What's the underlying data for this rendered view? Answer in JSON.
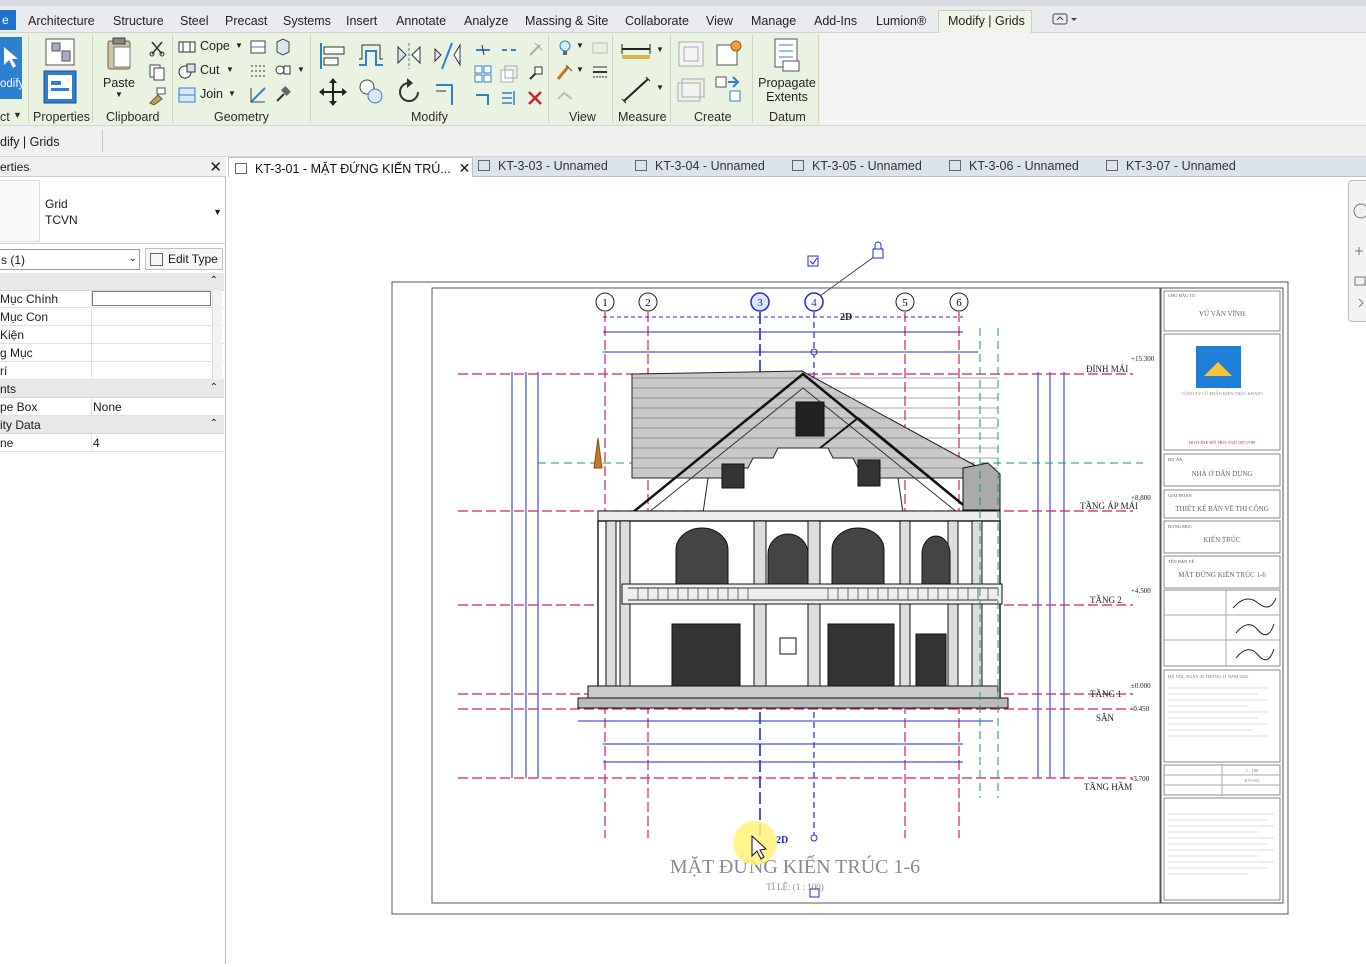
{
  "menu": {
    "file_label": "e",
    "tabs": [
      "Architecture",
      "Structure",
      "Steel",
      "Precast",
      "Systems",
      "Insert",
      "Annotate",
      "Analyze",
      "Massing & Site",
      "Collaborate",
      "View",
      "Manage",
      "Add-Ins",
      "Lumion®",
      "Modify | Grids"
    ],
    "active_tab": "Modify | Grids"
  },
  "ribbon": {
    "modify_label": "odify",
    "select_label": "ct",
    "properties_label": "Properties",
    "paste_label": "Paste",
    "clipboard_label": "Clipboard",
    "cope_label": "Cope",
    "cut_label": "Cut",
    "join_label": "Join",
    "geometry_label": "Geometry",
    "modify_panel_label": "Modify",
    "view_label": "View",
    "measure_label": "Measure",
    "create_label": "Create",
    "propagate_line1": "Propagate",
    "propagate_line2": "Extents",
    "datum_label": "Datum"
  },
  "options_bar": {
    "context_label": "dify | Grids"
  },
  "properties": {
    "title": "erties",
    "type_line1": "Grid",
    "type_line2": "TCVN",
    "filter_value": "s (1)",
    "edit_type_label": "Edit Type",
    "rows": [
      {
        "key": " Mục Chính",
        "value": ""
      },
      {
        "key": " Mục Con",
        "value": ""
      },
      {
        "key": " Kiện",
        "value": ""
      },
      {
        "key": "g Mục",
        "value": ""
      },
      {
        "key": "rí",
        "value": ""
      }
    ],
    "group_extents": "nts",
    "scope_box_key": "pe Box",
    "scope_box_value": "None",
    "group_identity": "ity Data",
    "name_key": "ne",
    "name_value": "4"
  },
  "doc_tabs": [
    {
      "label": "KT-3-01 - MẶT ĐỨNG KIẾN TRÚ...",
      "active": true
    },
    {
      "label": "KT-3-03 - Unnamed",
      "active": false
    },
    {
      "label": "KT-3-04 - Unnamed",
      "active": false
    },
    {
      "label": "KT-3-05 - Unnamed",
      "active": false
    },
    {
      "label": "KT-3-06 - Unnamed",
      "active": false
    },
    {
      "label": "KT-3-07 - Unnamed",
      "active": false
    }
  ],
  "drawing": {
    "grid_labels": [
      "1",
      "2",
      "3",
      "4",
      "5",
      "6"
    ],
    "tag_2d": "2D",
    "level_labels": [
      "ĐỈNH MÁI",
      "TẦNG ÁP MÁI",
      "TẦNG 2",
      "TẦNG 1",
      "SÂN",
      "TẦNG HẦM"
    ],
    "level_values": [
      "+15.300",
      "+8.800",
      "+4.500",
      "±0.000",
      "-0.450",
      "-3.700"
    ],
    "view_title": "MẶT ĐỨNG KIẾN TRÚC 1-6",
    "scale_text": "TỈ LỆ: (1 : 100)",
    "titleblock": {
      "owner_label": "CHỦ ĐẦU TƯ",
      "owner": "VŨ VĂN VĨNH",
      "company": "CÔNG TY CỔ PHẦN KIẾN TRÚC KBATO",
      "hotline": "HOTLINE HỖ TRỢ: 0347.097.0789",
      "project_label": "DỰ ÁN",
      "project": "NHÀ Ở DÂN DỤNG",
      "phase_label": "GIAI ĐOẠN",
      "phase": "THIẾT KẾ BẢN VẼ THI CÔNG",
      "discipline_label": "HẠNG MỤC",
      "discipline": "KIẾN TRÚC",
      "sheet_name_label": "TÊN BẢN VẼ",
      "sheet_name": "MẶT ĐỨNG KIẾN TRÚC 1-6",
      "date": "HÀ NỘI, NGÀY 25 THÁNG 11 NĂM 2022",
      "scale": "1 : 100",
      "sheet_no": "KT-3-01"
    }
  },
  "colors": {
    "accent": "#1e72c8",
    "context_tab": "#eaf3e1",
    "dim_blue": "#1f2bd1",
    "level_magenta": "#d61f6a",
    "grid_green": "#18a34a"
  }
}
